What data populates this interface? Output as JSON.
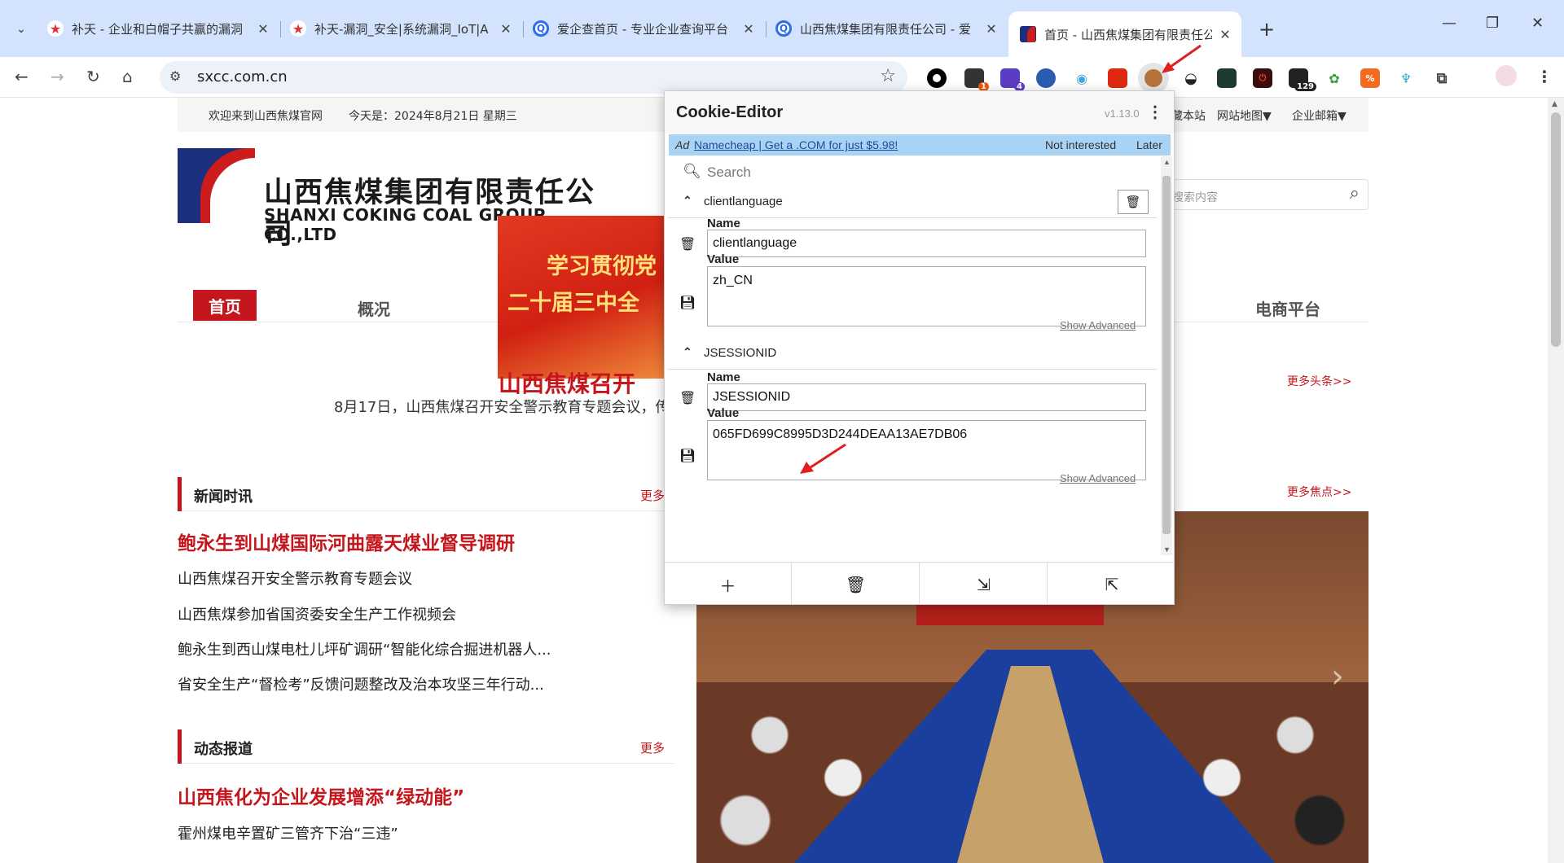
{
  "browser": {
    "tabs": [
      {
        "title": "补天 - 企业和白帽子共赢的漏洞",
        "favicon": "star"
      },
      {
        "title": "补天-漏洞_安全|系统漏洞_IoT|A",
        "favicon": "star"
      },
      {
        "title": "爱企查首页 - 专业企业查询平台",
        "favicon": "Q"
      },
      {
        "title": "山西焦煤集团有限责任公司 - 爱",
        "favicon": "Q"
      },
      {
        "title": "首页 - 山西焦煤集团有限责任公",
        "favicon": "sxcc"
      }
    ],
    "url": "sxcc.com.cn",
    "extension_badges": {
      "ext1": "1",
      "ext2": "4",
      "ext3": "129"
    }
  },
  "site": {
    "topbar": {
      "welcome": "欢迎来到山西焦煤官网",
      "date": "今天是：2024年8月21日 星期三",
      "links": [
        "藏本站",
        "网站地图▼",
        "企业邮箱▼"
      ]
    },
    "logo": {
      "cn": "山西焦煤集团有限责任公司",
      "en": "SHANXI COKING COAL GROUP CO.,LTD"
    },
    "search_placeholder": "搜索内容",
    "banner": {
      "line1": "学习贯彻党",
      "line2": "二十届三中全"
    },
    "nav": [
      "首页",
      "概况",
      "电商平台"
    ],
    "headline": "山西焦煤召开",
    "subline": "8月17日，山西焦煤召开安全警示教育专题会议，传达",
    "more_headlines": "更多头条>>",
    "more_focus": "更多焦点>>",
    "news": {
      "title": "新闻时讯",
      "more": "更多",
      "lead": "鲍永生到山煤国际河曲露天煤业督导调研",
      "items": [
        "山西焦煤召开安全警示教育专题会议",
        "山西焦煤参加省国资委安全生产工作视频会",
        "鲍永生到西山煤电杜儿坪矿调研“智能化综合掘进机器人...",
        "省安全生产“督检考”反馈问题整改及治本攻坚三年行动..."
      ]
    },
    "dynamic": {
      "title": "动态报道",
      "more": "更多",
      "lead": "山西焦化为企业发展增添“绿动能”",
      "items": [
        "霍州煤电辛置矿三管齐下治“三违”"
      ]
    }
  },
  "cookie_editor": {
    "title": "Cookie-Editor",
    "version": "v1.13.0",
    "ad": {
      "label": "Ad",
      "link": "Namecheap | Get a .COM for just $5.98!",
      "not_interested": "Not interested",
      "later": "Later"
    },
    "search_placeholder": "Search",
    "cookies": [
      {
        "name": "clientlanguage",
        "name_label": "Name",
        "value_label": "Value",
        "value": "zh_CN",
        "show_advanced": "Show Advanced"
      },
      {
        "name": "JSESSIONID",
        "name_label": "Name",
        "value_label": "Value",
        "value": "065FD699C8995D3D244DEAA13AE7DB06",
        "show_advanced": "Show Advanced"
      }
    ]
  },
  "colors": {
    "brand_red": "#c4161c",
    "ad_blue": "#a9d3f5",
    "tabstrip": "#d3e3fd",
    "annotation_red": "#e02020"
  }
}
